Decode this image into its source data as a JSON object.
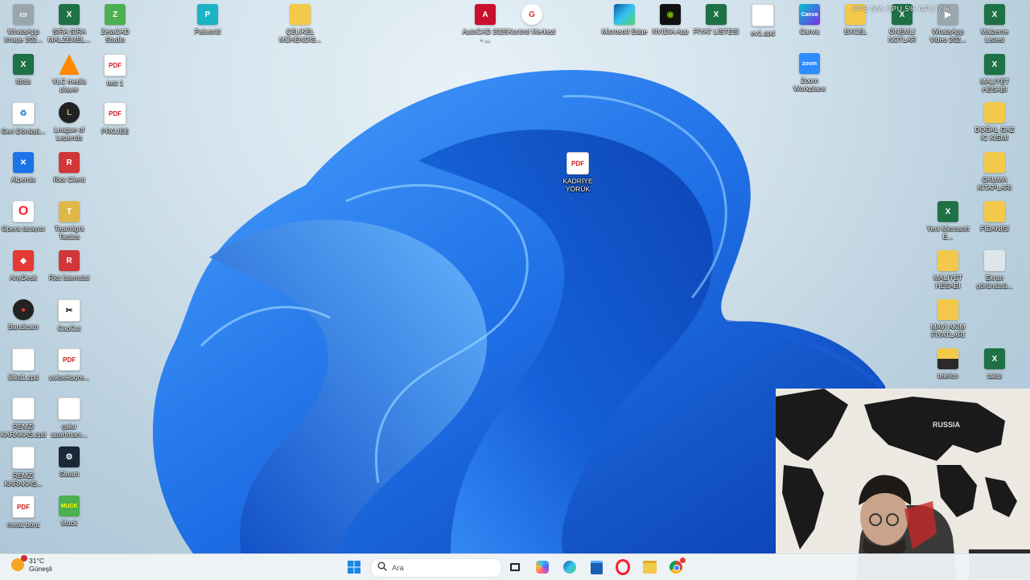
{
  "desktop_icons": [
    {
      "label": "WhatsApp Image 202...",
      "icon": "image-file-icon"
    },
    {
      "label": "SIRA SIRA MALZEMEL...",
      "icon": "excel-icon"
    },
    {
      "label": "ZetaCAD Studio",
      "icon": "zetacad-icon"
    },
    {
      "label": "Palworld",
      "icon": "palworld-icon"
    },
    {
      "label": "ÇELİKEL MÜHENDİS...",
      "icon": "folder-icon"
    },
    {
      "label": "AutoCAD 2025 - ...",
      "icon": "autocad-icon"
    },
    {
      "label": "Kontrol Merkezi",
      "icon": "control-center-icon"
    },
    {
      "label": "Microsoft Edge",
      "icon": "edge-icon"
    },
    {
      "label": "NVIDIA App",
      "icon": "nvidia-icon"
    },
    {
      "label": "FİYAT LİSTESİ",
      "icon": "excel-icon"
    },
    {
      "label": "ev1.zpd",
      "icon": "file-icon"
    },
    {
      "label": "Canva",
      "icon": "canva-icon"
    },
    {
      "label": "EXCEL",
      "icon": "folder-icon"
    },
    {
      "label": "ÖNEMLİ NOTLAR",
      "icon": "excel-icon"
    },
    {
      "label": "WhatsApp Video 202...",
      "icon": "video-file-icon"
    },
    {
      "label": "Malzeme Listesi",
      "icon": "excel-icon"
    },
    {
      "label": "fdfds",
      "icon": "excel-icon"
    },
    {
      "label": "VLC media player",
      "icon": "vlc-icon"
    },
    {
      "label": "test 1",
      "icon": "pdf-icon"
    },
    {
      "label": "Zoom Workplace",
      "icon": "zoom-icon"
    },
    {
      "label": "MALİYET HESABI",
      "icon": "excel-icon"
    },
    {
      "label": "Geri Dönüşü...",
      "icon": "recycle-bin-icon"
    },
    {
      "label": "League of Legends",
      "icon": "league-icon"
    },
    {
      "label": "PROJEE",
      "icon": "pdf-icon"
    },
    {
      "label": "DOĞAL GAZ İÇ KISMI",
      "icon": "folder-icon"
    },
    {
      "label": "KADRİYE YÖRÜK",
      "icon": "pdf-icon"
    },
    {
      "label": "Alpemix",
      "icon": "alpemix-icon"
    },
    {
      "label": "Riot Client",
      "icon": "riot-icon"
    },
    {
      "label": "OKUMA KİTAPLARI",
      "icon": "folder-icon"
    },
    {
      "label": "Opera tarayıcı",
      "icon": "opera-icon"
    },
    {
      "label": "Teamfight Tactics",
      "icon": "tft-icon"
    },
    {
      "label": "Yeni Microsoft E...",
      "icon": "excel-icon"
    },
    {
      "label": "FİDANİŞİ",
      "icon": "folder-icon"
    },
    {
      "label": "AnyDesk",
      "icon": "anydesk-icon"
    },
    {
      "label": "Riot İstemcisi",
      "icon": "riot-icon"
    },
    {
      "label": "MALİYET HESABI",
      "icon": "folder-icon"
    },
    {
      "label": "Ekran görüntüsü...",
      "icon": "screenshot-icon"
    },
    {
      "label": "Bandicam",
      "icon": "bandicam-icon"
    },
    {
      "label": "CapCut",
      "icon": "capcut-icon"
    },
    {
      "label": "MAVİ AKIM FİYATLARI",
      "icon": "folder-icon"
    },
    {
      "label": "Ülkü1.zpd",
      "icon": "file-icon"
    },
    {
      "label": "yuksekogre...",
      "icon": "pdf-icon"
    },
    {
      "label": "telefon",
      "icon": "folder-icon"
    },
    {
      "label": "takip",
      "icon": "excel-icon"
    },
    {
      "label": "REMZİ KARAKAŞ.zpd",
      "icon": "file-icon"
    },
    {
      "label": "çakır apartmanı...",
      "icon": "file-icon"
    },
    {
      "label": "REMZİ KARAKAŞ...",
      "icon": "file-icon"
    },
    {
      "label": "Steam",
      "icon": "steam-icon"
    },
    {
      "label": "metal boru",
      "icon": "pdf-icon"
    },
    {
      "label": "Muck",
      "icon": "muck-icon"
    }
  ],
  "overlay": {
    "text": "FPS N/A   CPU 5%   GPU 7%"
  },
  "webcam": {
    "map_label": "RUSSIA",
    "alt": "webcam overlay"
  },
  "taskbar": {
    "weather_temp": "31°C",
    "weather_desc": "Güneşli",
    "search_placeholder": "Ara",
    "apps": [
      "start-icon",
      "task-view-icon",
      "copilot-icon",
      "edge-icon",
      "store-icon",
      "opera-icon",
      "file-explorer-icon",
      "chrome-icon"
    ]
  },
  "colors": {
    "bloom_dark": "#0a3fb0",
    "bloom_mid": "#1f6fe6",
    "bloom_light": "#5cb0ff",
    "excel": "#1e7145",
    "folder": "#f3c94b"
  }
}
